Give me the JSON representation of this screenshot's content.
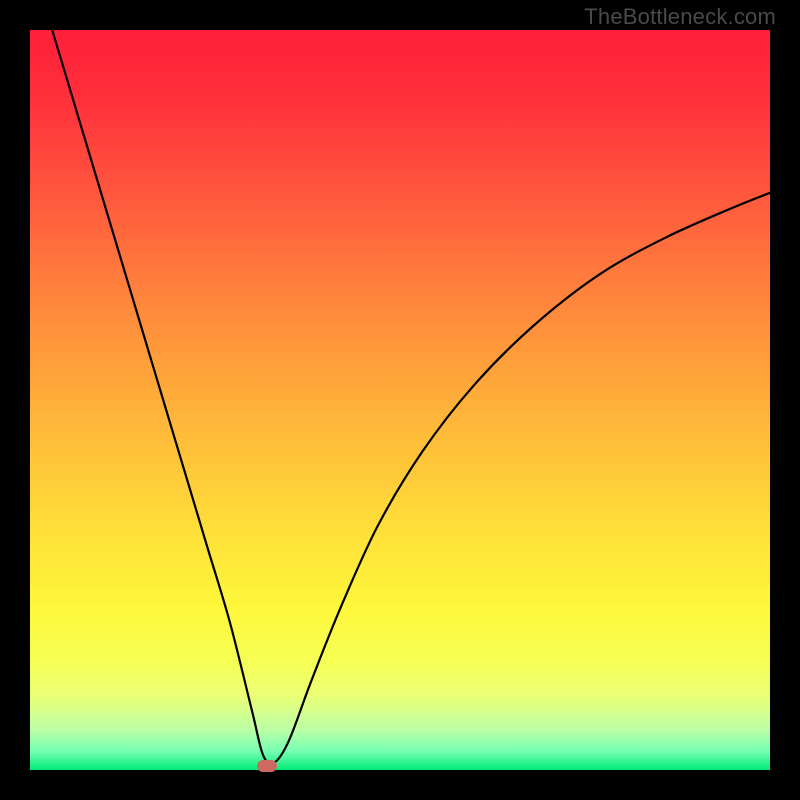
{
  "watermark": "TheBottleneck.com",
  "chart_data": {
    "type": "line",
    "title": "",
    "xlabel": "",
    "ylabel": "",
    "xlim": [
      0,
      100
    ],
    "ylim": [
      0,
      100
    ],
    "grid": false,
    "legend": false,
    "series": [
      {
        "name": "bottleneck-curve",
        "x": [
          3,
          6,
          9,
          12,
          15,
          18,
          21,
          24,
          27,
          30,
          31.5,
          33,
          35,
          38,
          42,
          47,
          53,
          60,
          68,
          77,
          86,
          95,
          100
        ],
        "y": [
          100,
          90,
          80,
          70,
          60,
          50,
          40,
          30,
          20,
          8,
          2,
          1,
          4,
          12,
          22,
          33,
          43,
          52,
          60,
          67,
          72,
          76,
          78
        ]
      }
    ],
    "marker": {
      "x": 32,
      "y": 0.5,
      "color": "#cc6a62"
    },
    "gradient_stops": [
      {
        "pos": 0.0,
        "color": "#ff1f3a"
      },
      {
        "pos": 0.5,
        "color": "#ffc539"
      },
      {
        "pos": 0.85,
        "color": "#f7ff53"
      },
      {
        "pos": 1.0,
        "color": "#00ec77"
      }
    ]
  }
}
